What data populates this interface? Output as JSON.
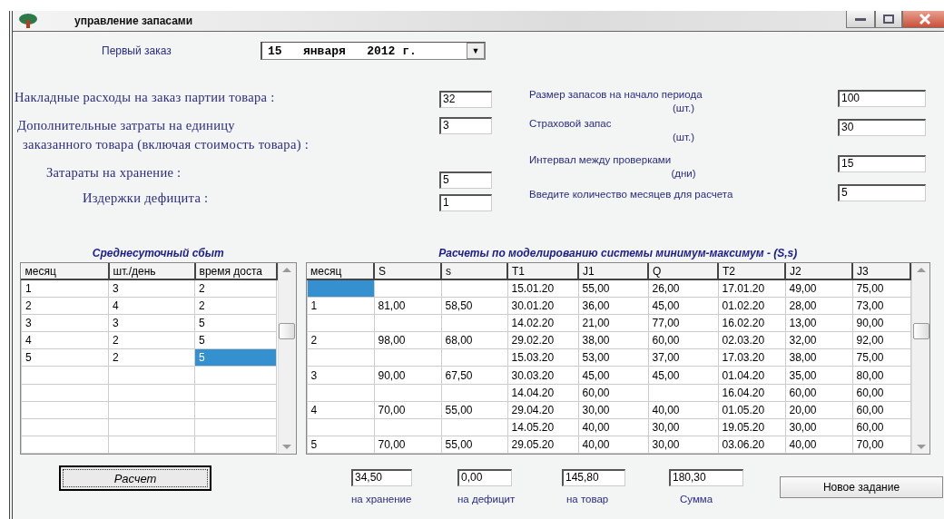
{
  "window": {
    "title": "управление запасами"
  },
  "first_order": {
    "label": "Первый заказ",
    "value": "15   января   2012 г.",
    "arrow": "▼"
  },
  "cost_params": [
    {
      "lines": [
        "Накладные  расходы  на заказ  партии товара :"
      ],
      "value": "32"
    },
    {
      "lines": [
        "Дополнительные затраты на единицу",
        "заказанного товара  (включая стоимость товара) :"
      ],
      "value": "3"
    },
    {
      "lines": [
        "Затараты  на  хранение :"
      ],
      "value": "5"
    },
    {
      "lines": [
        "Издержки  дефицита :"
      ],
      "value": "1"
    }
  ],
  "stock_params": [
    {
      "lines": [
        "Размер запасов на начало периода",
        "(шт.)"
      ],
      "value": "100"
    },
    {
      "lines": [
        "Страховой запас",
        "(шт.)"
      ],
      "value": "30"
    },
    {
      "lines": [
        "Интервал между проверками",
        "(дни)"
      ],
      "value": "15"
    },
    {
      "lines": [
        "Введите количество месяцев для расчета"
      ],
      "value": "5"
    }
  ],
  "sales_table": {
    "title": "Среднесуточный сбыт",
    "columns": [
      "месяц",
      "шт./день",
      "время доста"
    ],
    "rows": [
      {
        "cells": [
          "1",
          "3",
          "2"
        ],
        "selected": [
          false,
          false,
          false
        ]
      },
      {
        "cells": [
          "2",
          "4",
          "2"
        ],
        "selected": [
          false,
          false,
          false
        ]
      },
      {
        "cells": [
          "3",
          "3",
          "5"
        ],
        "selected": [
          false,
          false,
          false
        ]
      },
      {
        "cells": [
          "4",
          "2",
          "5"
        ],
        "selected": [
          false,
          false,
          false
        ]
      },
      {
        "cells": [
          "5",
          "2",
          "5"
        ],
        "selected": [
          false,
          false,
          true
        ]
      }
    ]
  },
  "model_table": {
    "title": "Расчеты по моделированию системы  минимум-максимум - (S,s)",
    "columns": [
      "месяц",
      "S",
      "s",
      "T1",
      "J1",
      "Q",
      "T2",
      "J2",
      "J3"
    ],
    "rows": [
      {
        "cells": [
          null,
          null,
          null,
          "15.01.20",
          "55,00",
          "26,00",
          "17.01.20",
          "49,00",
          "75,00"
        ],
        "selected": [
          true,
          false,
          false,
          false,
          false,
          false,
          false,
          false,
          false
        ]
      },
      {
        "cells": [
          "1",
          "81,00",
          "58,50",
          "30.01.20",
          "36,00",
          "45,00",
          "01.02.20",
          "28,00",
          "73,00"
        ],
        "selected": [
          false,
          false,
          false,
          false,
          false,
          false,
          false,
          false,
          false
        ]
      },
      {
        "cells": [
          null,
          null,
          null,
          "14.02.20",
          "21,00",
          "77,00",
          "16.02.20",
          "13,00",
          "90,00"
        ],
        "selected": [
          false,
          false,
          false,
          false,
          false,
          false,
          false,
          false,
          false
        ]
      },
      {
        "cells": [
          "2",
          "98,00",
          "68,00",
          "29.02.20",
          "38,00",
          "60,00",
          "02.03.20",
          "32,00",
          "92,00"
        ],
        "selected": [
          false,
          false,
          false,
          false,
          false,
          false,
          false,
          false,
          false
        ]
      },
      {
        "cells": [
          null,
          null,
          null,
          "15.03.20",
          "53,00",
          "37,00",
          "17.03.20",
          "38,00",
          "75,00"
        ],
        "selected": [
          false,
          false,
          false,
          false,
          false,
          false,
          false,
          false,
          false
        ]
      },
      {
        "cells": [
          "3",
          "90,00",
          "67,50",
          "30.03.20",
          "45,00",
          "45,00",
          "01.04.20",
          "35,00",
          "80,00"
        ],
        "selected": [
          false,
          false,
          false,
          false,
          false,
          false,
          false,
          false,
          false
        ]
      },
      {
        "cells": [
          null,
          null,
          null,
          "14.04.20",
          "60,00",
          null,
          "16.04.20",
          "60,00",
          "60,00"
        ],
        "selected": [
          false,
          false,
          false,
          false,
          false,
          false,
          false,
          false,
          false
        ]
      },
      {
        "cells": [
          "4",
          "70,00",
          "55,00",
          "29.04.20",
          "30,00",
          "40,00",
          "01.05.20",
          "20,00",
          "60,00"
        ],
        "selected": [
          false,
          false,
          false,
          false,
          false,
          false,
          false,
          false,
          false
        ]
      },
      {
        "cells": [
          null,
          null,
          null,
          "14.05.20",
          "40,00",
          "30,00",
          "19.05.20",
          "30,00",
          "60,00"
        ],
        "selected": [
          false,
          false,
          false,
          false,
          false,
          false,
          false,
          false,
          false
        ]
      },
      {
        "cells": [
          "5",
          "70,00",
          "55,00",
          "29.05.20",
          "40,00",
          "30,00",
          "03.06.20",
          "40,00",
          "70,00"
        ],
        "selected": [
          false,
          false,
          false,
          false,
          false,
          false,
          false,
          false,
          false
        ]
      }
    ]
  },
  "calculate_button": "Расчет",
  "results": [
    {
      "value": "34,50",
      "label": "на хранение"
    },
    {
      "value": "0,00",
      "label": "на дефицит"
    },
    {
      "value": "145,80",
      "label": "на товар"
    },
    {
      "value": "180,30",
      "label": "Сумма"
    }
  ],
  "new_task_button": "Новое задание"
}
